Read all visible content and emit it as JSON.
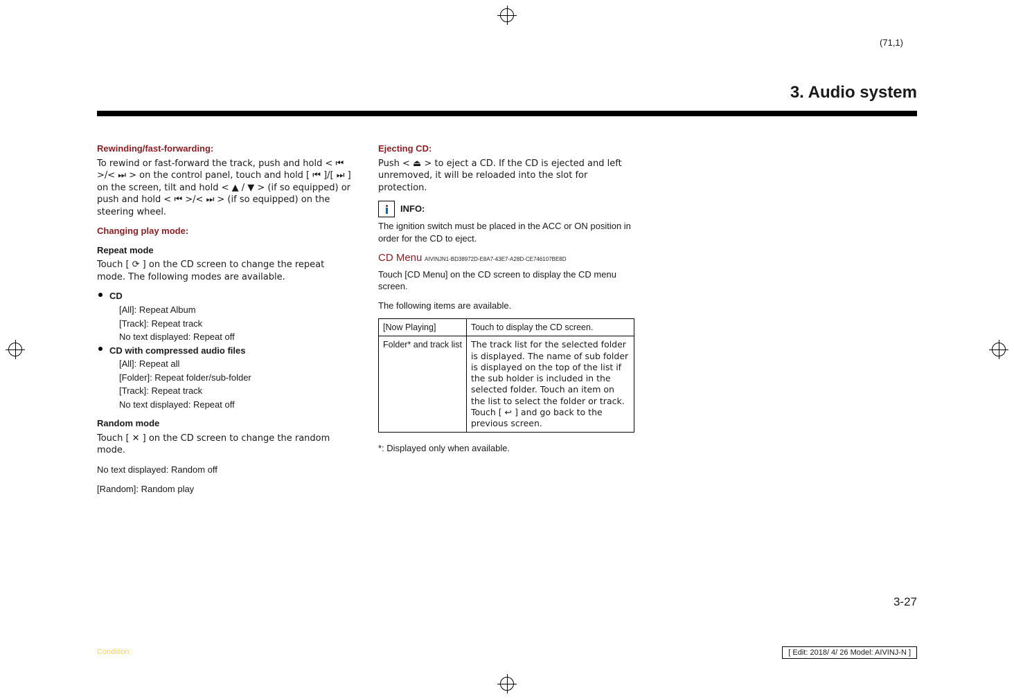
{
  "sheet_ref": "(71,1)",
  "chapter_title": "3. Audio system",
  "col1": {
    "h_rewind": "Rewinding/fast-forwarding:",
    "p_rewind": "To rewind or fast-forward the track, push and hold < ⏮ >/< ⏭ > on the control panel, touch and hold [ ⏮ ]/[ ⏭ ] on the screen, tilt and hold < ▲ / ▼ > (if so equipped) or push and hold < ⏮ >/< ⏭ > (if so equipped) on the steering wheel.",
    "h_mode": "Changing play mode:",
    "h_repeat": "Repeat mode",
    "p_repeat": "Touch [ ⟳ ] on the CD screen to change the repeat mode. The following modes are available.",
    "li_cd": "CD",
    "li_cd_all": "[All]: Repeat Album",
    "li_cd_track": "[Track]: Repeat track",
    "li_cd_none": "No text displayed: Repeat off",
    "li_comp": "CD with compressed audio files",
    "li_comp_all": "[All]: Repeat all",
    "li_comp_folder": "[Folder]: Repeat folder/sub-folder",
    "li_comp_track": "[Track]: Repeat track",
    "li_comp_none": "No text displayed: Repeat off",
    "h_random": "Random mode",
    "p_random1": "Touch [ ✕ ] on the CD screen to change the random mode.",
    "p_random2": "No text displayed: Random off",
    "p_random3": "[Random]: Random play"
  },
  "col2": {
    "h_eject": "Ejecting CD:",
    "p_eject": "Push < ⏏ > to eject a CD. If the CD is ejected and left unremoved, it will be reloaded into the slot for protection.",
    "info_label": "INFO:",
    "p_info": "The ignition switch must be placed in the ACC or ON position in order for the CD to eject.",
    "h_cdmenu": "CD Menu",
    "guid": "AIVINJN1-BD38972D-E8A7-43E7-A28D-CE746107BE8D",
    "p_cdmenu1": "Touch [CD Menu] on the CD screen to display the CD menu screen.",
    "p_cdmenu2": "The following items are available.",
    "table": {
      "r1k": "[Now Playing]",
      "r1v": "Touch to display the CD screen.",
      "r2k": "Folder* and track list",
      "r2v": "The track list for the selected folder is displayed. The name of sub folder is displayed on the top of the list if the sub holder is included in the selected folder.\nTouch an item on the list to select the folder or track. Touch [ ↩ ] and go back to the previous screen."
    },
    "footnote": "*: Displayed only when available."
  },
  "page_number": "3-27",
  "footer_left": "Condition:",
  "footer_right": "[ Edit: 2018/ 4/ 26   Model: AIVINJ-N ]"
}
